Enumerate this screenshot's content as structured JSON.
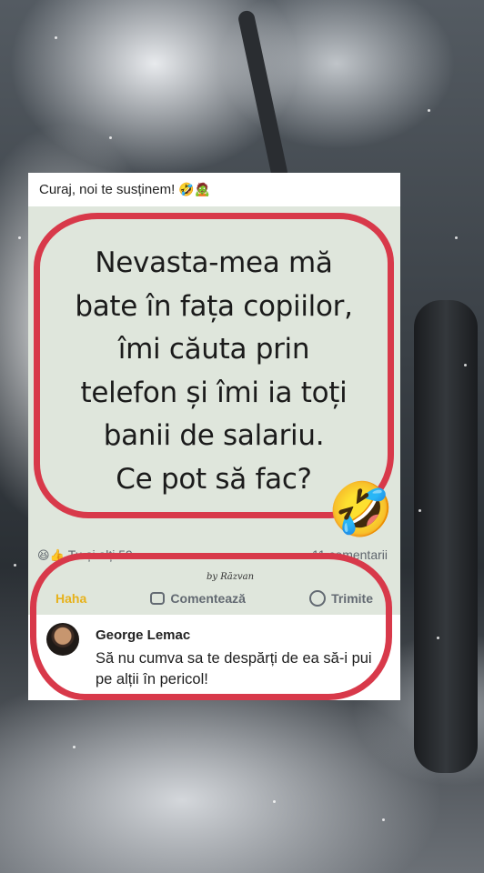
{
  "post": {
    "caption": "Curaj, noi te susținem!",
    "caption_emojis": "🤣🧟",
    "quote_lines": [
      "Nevasta-mea mă",
      "bate în fața copiilor,",
      "îmi căuta prin",
      "telefon și îmi ia toți",
      "banii de salariu.",
      "Ce pot să fac?"
    ],
    "laugh_emoji": "🤣",
    "reactions_icons": "😆👍",
    "reactions_text": "Tu și alți 59",
    "comments_count": "11 comentarii",
    "watermark": "by Răzvan",
    "actions": {
      "haha": "Haha",
      "comment": "Comentează",
      "send": "Trimite"
    },
    "comment": {
      "author": "George Lemac",
      "text": "Să nu cumva sa te despărți de ea să-i pui pe alții în pericol!"
    }
  },
  "colors": {
    "highlight_red": "#d8394a",
    "haha_yellow": "#e7b21b",
    "image_bg": "#dfe6dc"
  }
}
